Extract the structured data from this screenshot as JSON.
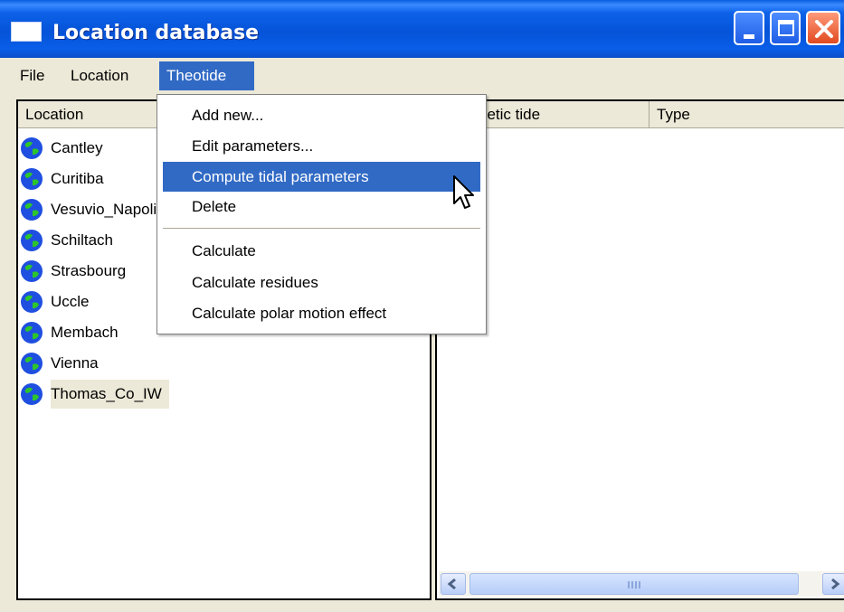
{
  "window": {
    "title": "Location database",
    "buttons": [
      "minimize",
      "maximize",
      "close"
    ]
  },
  "menubar": {
    "items": [
      "File",
      "Location",
      "Theotide"
    ],
    "active": "Theotide"
  },
  "theotide_menu": {
    "items": [
      "Add new...",
      "Edit parameters...",
      "Compute tidal parameters",
      "Delete",
      "Calculate",
      "Calculate residues",
      "Calculate polar motion effect"
    ],
    "highlighted": "Compute tidal parameters"
  },
  "left_pane": {
    "column_header": "Location",
    "locations": [
      "Cantley",
      "Curitiba",
      "Vesuvio_Napoli",
      "Schiltach",
      "Strasbourg",
      "Uccle",
      "Membach",
      "Vienna",
      "Thomas_Co_IW"
    ],
    "selected": "Thomas_Co_IW",
    "icon": "globe-icon"
  },
  "right_pane": {
    "columns": [
      "Synthetic tide",
      "Type"
    ]
  },
  "colors": {
    "titlebar": "#0553d8",
    "highlight": "#316ac5",
    "window_bg": "#ece9d8"
  }
}
